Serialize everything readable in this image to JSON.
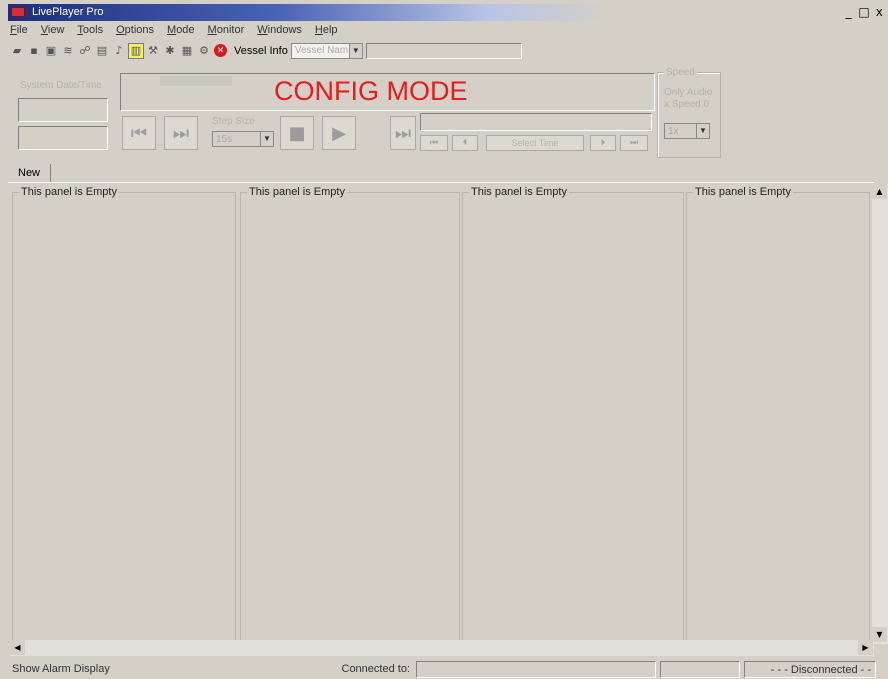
{
  "window": {
    "title": "LivePlayer Pro",
    "controls": [
      "_",
      "□",
      "x"
    ]
  },
  "menu": [
    "File",
    "View",
    "Tools",
    "Options",
    "Mode",
    "Monitor",
    "Windows",
    "Help"
  ],
  "toolbar": {
    "vessel_label": "Vessel Info",
    "vessel_combo": "Vessel Nam"
  },
  "system_panel": {
    "label": "System Date/Time"
  },
  "mode_banner": "CONFIG MODE",
  "playback": {
    "step_size_label": "Step Size",
    "step_size_value": "15s",
    "select_time_label": "Select Time"
  },
  "speed": {
    "label": "Speed",
    "options": [
      "Only Audio",
      "x Speed 0"
    ],
    "value": "1x"
  },
  "tabs": [
    "New"
  ],
  "panels": [
    {
      "title": "This panel is Empty"
    },
    {
      "title": "This panel is Empty"
    },
    {
      "title": "This panel is Empty"
    },
    {
      "title": "This panel is Empty"
    }
  ],
  "status": {
    "left": "Show Alarm Display",
    "connected_label": "Connected to:",
    "connection": "- - - Disconnected - -"
  }
}
